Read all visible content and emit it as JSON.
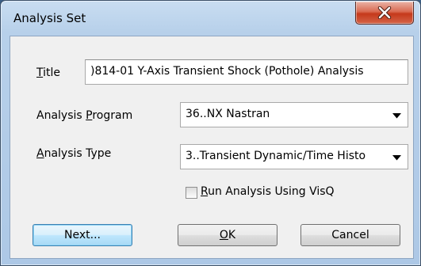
{
  "window": {
    "title": "Analysis Set",
    "close_label": "X"
  },
  "form": {
    "title_label_key": "T",
    "title_label_rest": "itle",
    "title_value": ")814-01 Y-Axis Transient Shock (Pothole) Analysis",
    "program_label_pre": "Analysis ",
    "program_label_key": "P",
    "program_label_rest": "rogram",
    "program_value": "36..NX Nastran",
    "type_label_key": "A",
    "type_label_rest": "nalysis Type",
    "type_value": "3..Transient Dynamic/Time Histo",
    "visq_label_key": "R",
    "visq_label_rest": "un Analysis Using VisQ",
    "visq_checked": false
  },
  "buttons": {
    "next_label": "Next...",
    "ok_key": "O",
    "ok_rest": "K",
    "cancel_label": "Cancel"
  },
  "icons": {
    "close": "close-x-icon",
    "dropdown": "chevron-down-icon"
  }
}
